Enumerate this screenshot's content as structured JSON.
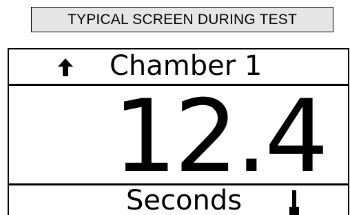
{
  "caption": "TYPICAL SCREEN DURING TEST",
  "display": {
    "header_icon": "up-arrow-icon",
    "chamber_label": "Chamber 1",
    "reading": "12.4",
    "units": "Seconds",
    "status_icon": "thermometer-icon"
  },
  "colors": {
    "caption_bg": "#e6e6e6",
    "foreground": "#000000",
    "background": "#ffffff"
  }
}
